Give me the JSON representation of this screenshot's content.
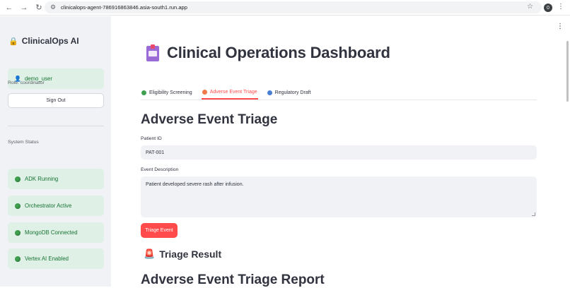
{
  "browser": {
    "url": "clinicalops-agent-786916863846.asia-south1.run.app",
    "profile_initial": "0",
    "back_icon": "←",
    "forward_icon": "→",
    "reload_icon": "↻",
    "site_info_icon": "⚙",
    "star_icon": "☆",
    "menu_icon": "⋮"
  },
  "sidebar": {
    "app_title": "ClinicalOps AI",
    "lock_icon": "🔒",
    "user_icon": "👤",
    "username": "demo_user",
    "role": "Role: coordinator",
    "sign_out_label": "Sign Out",
    "system_status_label": "System Status",
    "status_items": [
      {
        "label": "ADK Running",
        "color": "#3fa14f"
      },
      {
        "label": "Orchestrator Active",
        "color": "#3fa14f"
      },
      {
        "label": "MongoDB Connected",
        "color": "#3fa14f"
      },
      {
        "label": "Vertex AI Enabled",
        "color": "#3fa14f"
      }
    ]
  },
  "main": {
    "menu_icon": "⋮",
    "page_title": "Clinical Operations Dashboard",
    "tabs": [
      {
        "label": "Eligibility Screening",
        "dot_color": "#3fa14f",
        "active": false
      },
      {
        "label": "Adverse Event Triage",
        "dot_color": "#f07a4a",
        "active": true
      },
      {
        "label": "Regulatory Draft",
        "dot_color": "#4a7fd4",
        "active": false
      }
    ],
    "section_title": "Adverse Event Triage",
    "patient_id_label": "Patient ID",
    "patient_id_value": "PAT-001",
    "event_description_label": "Event Description",
    "event_description_value": "Patient developed severe rash after infusion.",
    "triage_button_label": "Triage Event",
    "siren_icon": "🚨",
    "result_title": "Triage Result",
    "report_title": "Adverse Event Triage Report"
  },
  "colors": {
    "accent": "#ff4b4b",
    "sidebar_bg": "#f0f2f6",
    "status_pill_bg": "#dff1e6",
    "status_text": "#177233"
  }
}
